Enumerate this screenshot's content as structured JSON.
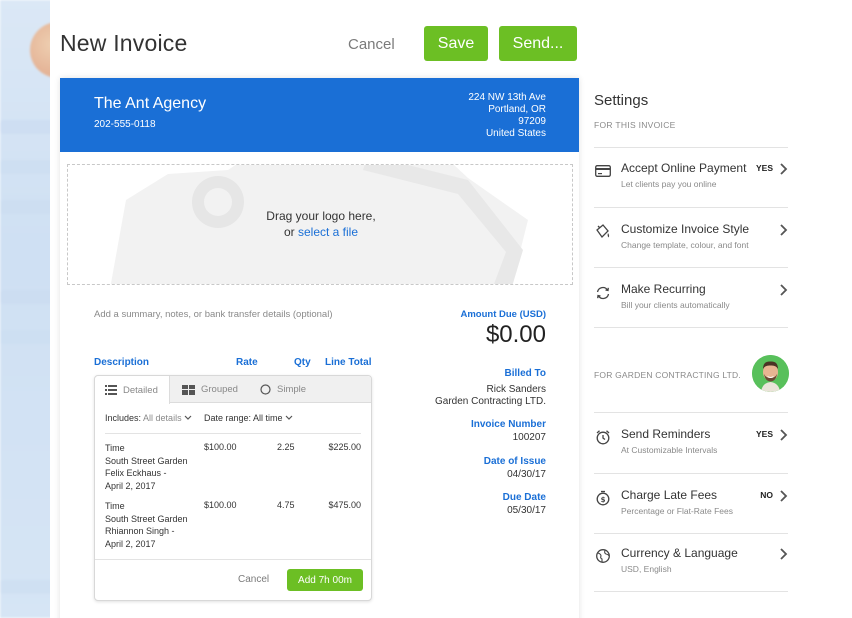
{
  "page": {
    "title": "New Invoice",
    "cancel_label": "Cancel",
    "save_label": "Save",
    "send_label": "Send..."
  },
  "colors": {
    "brand_blue": "#1a6fd6",
    "action_green": "#6cbf24"
  },
  "invoice": {
    "company_name": "The Ant Agency",
    "company_phone": "202-555-0118",
    "address": [
      "224 NW 13th Ave",
      "Portland, OR",
      "97209",
      "United States"
    ],
    "logo_drop_line1": "Drag your logo here,",
    "logo_drop_or": "or",
    "logo_drop_link": "select a file",
    "summary_placeholder": "Add a summary, notes, or bank transfer details (optional)",
    "amount_due_label": "Amount Due (USD)",
    "amount_due_value": "$0.00",
    "columns": {
      "description": "Description",
      "rate": "Rate",
      "qty": "Qty",
      "line_total": "Line Total"
    },
    "billed_to_label": "Billed To",
    "billed_to": [
      "Rick Sanders",
      "Garden Contracting LTD."
    ],
    "invoice_number_label": "Invoice Number",
    "invoice_number": "100207",
    "date_of_issue_label": "Date of Issue",
    "date_of_issue": "04/30/17",
    "due_date_label": "Due Date",
    "due_date": "05/30/17"
  },
  "time_panel": {
    "tabs": [
      {
        "label": "Detailed",
        "icon": "list-icon"
      },
      {
        "label": "Grouped",
        "icon": "grid-icon"
      },
      {
        "label": "Simple",
        "icon": "circle-icon"
      }
    ],
    "includes_label": "Includes:",
    "includes_value": "All details",
    "date_range_label": "Date range:",
    "date_range_value": "All time",
    "entries": [
      {
        "lines": [
          "Time",
          "South Street Garden",
          "Felix Eckhaus -",
          "April 2, 2017"
        ],
        "rate": "$100.00",
        "qty": "2.25",
        "total": "$225.00"
      },
      {
        "lines": [
          "Time",
          "South Street Garden",
          "Rhiannon Singh -",
          "April 2, 2017"
        ],
        "rate": "$100.00",
        "qty": "4.75",
        "total": "$475.00"
      }
    ],
    "cancel_label": "Cancel",
    "add_label": "Add 7h 00m"
  },
  "settings": {
    "title": "Settings",
    "for_invoice_label": "FOR THIS INVOICE",
    "invoice_items": [
      {
        "title": "Accept Online Payment",
        "desc": "Let clients pay you online",
        "value": "YES",
        "icon": "credit-card-icon"
      },
      {
        "title": "Customize Invoice Style",
        "desc": "Change template, colour, and font",
        "value": "",
        "icon": "paint-bucket-icon"
      },
      {
        "title": "Make Recurring",
        "desc": "Bill your clients automatically",
        "value": "",
        "icon": "recurring-icon"
      }
    ],
    "client_label": "FOR GARDEN CONTRACTING LTD.",
    "client_items": [
      {
        "title": "Send Reminders",
        "desc": "At Customizable Intervals",
        "value": "YES",
        "icon": "alarm-clock-icon"
      },
      {
        "title": "Charge Late Fees",
        "desc": "Percentage or Flat-Rate Fees",
        "value": "NO",
        "icon": "late-fee-icon"
      },
      {
        "title": "Currency & Language",
        "desc": "USD, English",
        "value": "",
        "icon": "globe-icon"
      }
    ]
  }
}
